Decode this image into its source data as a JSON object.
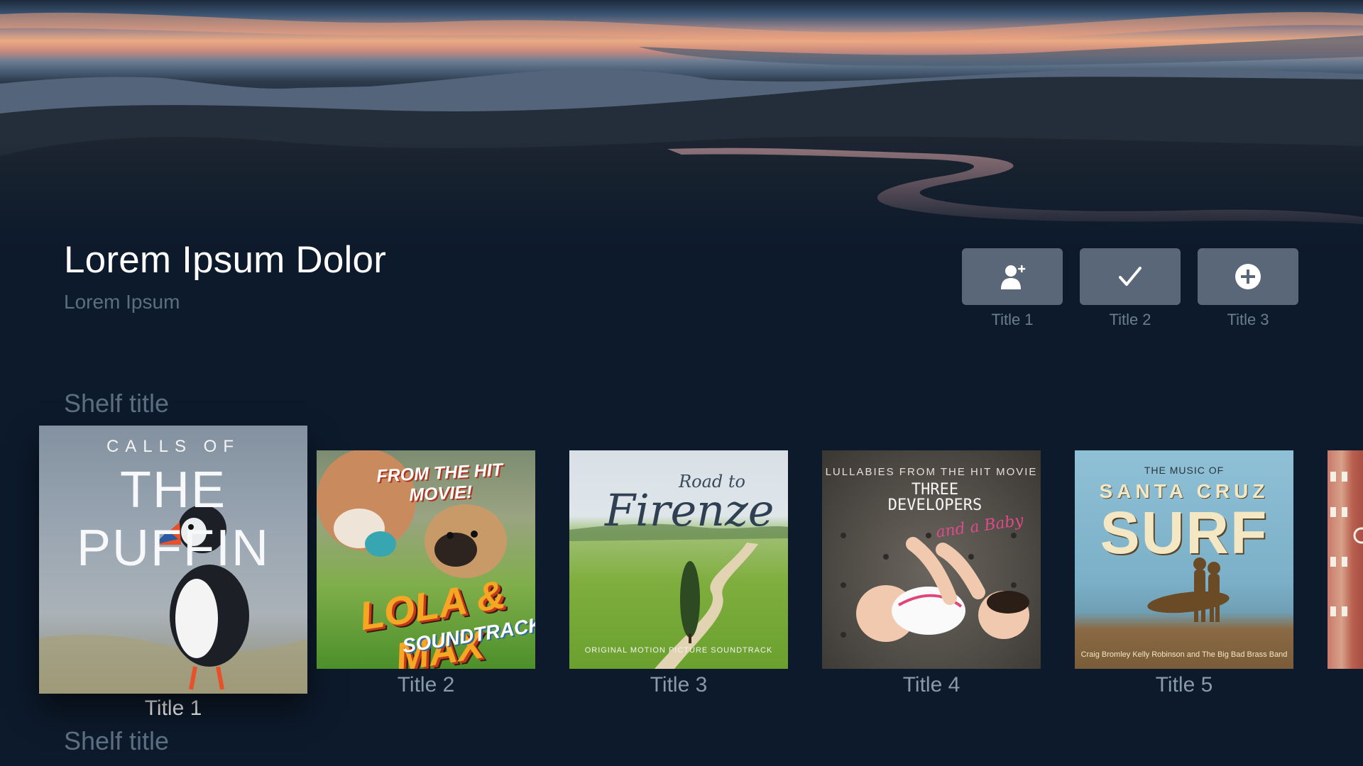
{
  "header": {
    "title": "Lorem Ipsum Dolor",
    "subtitle": "Lorem Ipsum"
  },
  "actions": [
    {
      "label": "Title 1",
      "icon": "add-person-icon"
    },
    {
      "label": "Title 2",
      "icon": "checkmark-icon"
    },
    {
      "label": "Title 3",
      "icon": "plus-circle-icon"
    }
  ],
  "shelves": [
    {
      "title": "Shelf title",
      "items": [
        {
          "title": "Title 1",
          "focused": true,
          "art_lines": [
            "CALLS OF",
            "THE PUFFIN"
          ]
        },
        {
          "title": "Title 2",
          "art_lines": [
            "FROM THE HIT MOVIE!",
            "LOLA & MAX",
            "SOUNDTRACK"
          ]
        },
        {
          "title": "Title 3",
          "art_lines": [
            "Road to",
            "Firenze",
            "ORIGINAL MOTION PICTURE SOUNDTRACK"
          ]
        },
        {
          "title": "Title 4",
          "art_lines": [
            "LULLABIES FROM THE HIT MOVIE",
            "THREE DEVELOPERS",
            "and a Baby"
          ]
        },
        {
          "title": "Title 5",
          "art_lines": [
            "THE MUSIC OF",
            "SANTA CRUZ",
            "SURF",
            "Craig Bromley   Kelly Robinson   and The Big Bad Brass Band"
          ]
        }
      ]
    },
    {
      "title": "Shelf title"
    }
  ],
  "colors": {
    "background": "#0d1a2b",
    "button": "#5a6778",
    "muted_text": "#5c6e82"
  }
}
